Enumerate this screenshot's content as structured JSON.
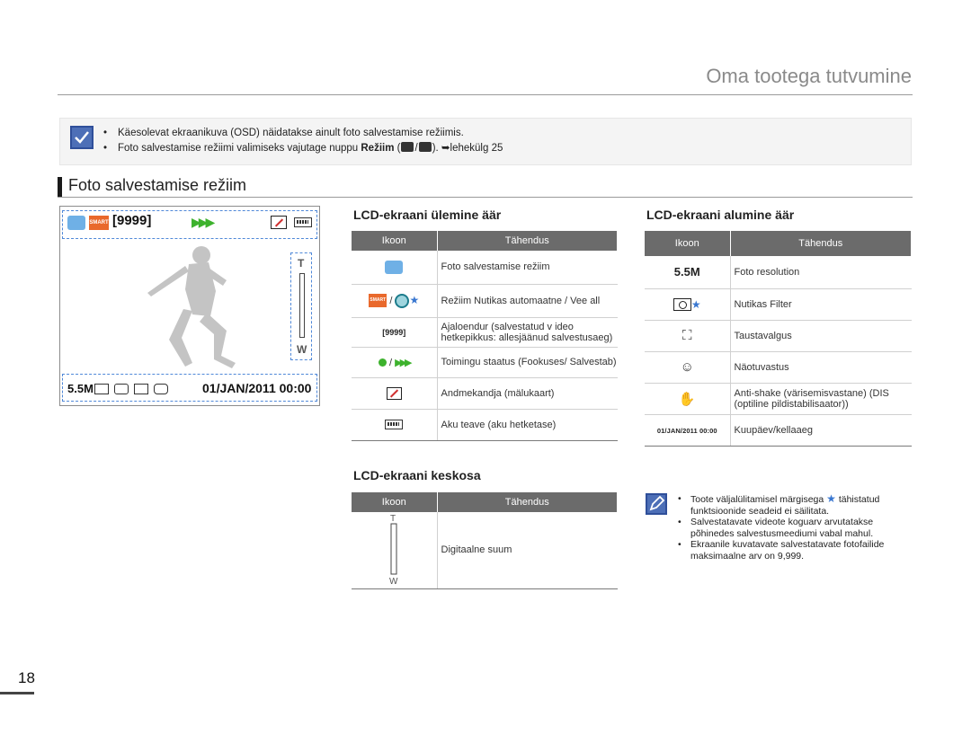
{
  "header": {
    "chapter_title": "Oma tootega tutvumine"
  },
  "note": {
    "item1": "Käesolevat ekraanikuva (OSD) näidatakse ainult foto salvestamise režiimis.",
    "item2_prefix": "Foto salvestamise režiimi valimiseks vajutage nuppu ",
    "item2_bold": "Režiim",
    "item2_middle": " (",
    "item2_slash": "/",
    "item2_suffix": "). ➥lehekülg 25"
  },
  "section": {
    "title": "Foto salvestamise režiim"
  },
  "lcd": {
    "count": "[9999]",
    "datetime": "01/JAN/2011 00:00",
    "resolution": "5.5M",
    "smart": "SMART",
    "zoom_t": "T",
    "zoom_w": "W"
  },
  "table_top": {
    "title": "LCD-ekraani ülemine äär",
    "col_icon": "Ikoon",
    "col_meaning": "Tähendus",
    "rows": [
      {
        "icon": "camera-icon",
        "meaning": "Foto salvestamise režiim"
      },
      {
        "icon": "smart-auto-icon",
        "slash": "/",
        "meaning": "Režiim Nutikas automaatne / Vee all"
      },
      {
        "icon_text": "[9999]",
        "meaning": "Ajaloendur (salvestatud v  ideo hetkepikkus: allesjäänud salvestusaeg)"
      },
      {
        "icon": "focus-status-icon",
        "slash": "/",
        "meaning": "Toimingu staatus (Fookuses/ Salvestab)"
      },
      {
        "icon": "memory-card-icon",
        "meaning": "Andmekandja (mälukaart)"
      },
      {
        "icon": "battery-icon",
        "meaning": "Aku teave (aku hetketase)"
      }
    ]
  },
  "table_bottom": {
    "title": "LCD-ekraani alumine äär",
    "col_icon": "Ikoon",
    "col_meaning": "Tähendus",
    "rows": [
      {
        "icon_text": "5.5M",
        "meaning": "Foto resolution"
      },
      {
        "icon": "smart-filter-icon",
        "meaning": "Nutikas Filter"
      },
      {
        "icon": "backlight-icon",
        "meaning": "Taustavalgus"
      },
      {
        "icon": "face-detection-icon",
        "meaning": "Näotuvastus"
      },
      {
        "icon": "anti-shake-icon",
        "meaning": "Anti-shake (värisemisvastane) (DIS (optiline pildistabilisaator))"
      },
      {
        "icon_text": "01/JAN/2011  00:00",
        "meaning": "Kuupäev/kellaaeg"
      }
    ]
  },
  "table_center": {
    "title": "LCD-ekraani keskosa",
    "col_icon": "Ikoon",
    "col_meaning": "Tähendus",
    "rows": [
      {
        "icon": "digital-zoom-icon",
        "meaning": "Digitaalne suum"
      }
    ]
  },
  "note2": {
    "item1_prefix": "Toote väljalülitamisel märgisega ",
    "item1_suffix": " tähistatud funktsioonide seadeid ei säilitata.",
    "item2": "Salvestatavate videote koguarv arvutatakse põhinedes salvestusmeediumi vabal mahul.",
    "item3": "Ekraanile kuvatavate salvestatavate fotofailide maksimaalne arv on 9,999."
  },
  "footer": {
    "page_number": "18"
  },
  "colors": {
    "accent_blue": "#4d6fb7",
    "header_gray": "#6b6b6b",
    "smart_orange": "#e9692c",
    "focus_green": "#3db22d"
  }
}
